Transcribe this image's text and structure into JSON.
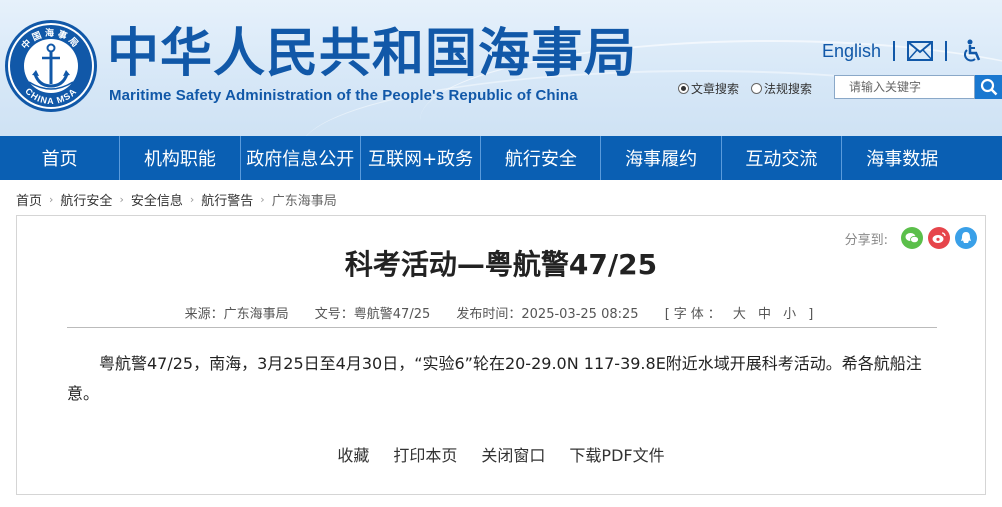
{
  "header": {
    "title_cn": "中华人民共和国海事局",
    "title_en": "Maritime Safety Administration of the People's Republic of China",
    "logo": {
      "ring_text_top": "中国海事局",
      "ring_text_bottom": "CHINA MSA",
      "icon": "anchor-emblem-icon"
    },
    "english_link": "English",
    "mail_icon": "mail-icon",
    "accessibility_icon": "accessibility-icon",
    "search": {
      "option1": "文章搜索",
      "option2": "法规搜索",
      "placeholder": "请输入关键字",
      "button_icon": "search-icon"
    }
  },
  "nav": [
    "首页",
    "机构职能",
    "政府信息公开",
    "互联网+政务",
    "航行安全",
    "海事履约",
    "互动交流",
    "海事数据"
  ],
  "breadcrumb": [
    "首页",
    "航行安全",
    "安全信息",
    "航行警告",
    "广东海事局"
  ],
  "article": {
    "share_label": "分享到:",
    "title": "科考活动—粤航警47/25",
    "meta": {
      "source": "来源：广东海事局",
      "doc_no": "文号：粤航警47/25",
      "published": "发布时间：2025-03-25 08:25",
      "font_size": "[字体： 大 中 小 ]"
    },
    "body": "粤航警47/25，南海，3月25日至4月30日，“实验6”轮在20-29.0N 117-39.8E附近水域开展科考活动。希各航船注意。",
    "actions": [
      "收藏",
      "打印本页",
      "关闭窗口",
      "下载PDF文件"
    ]
  },
  "colors": {
    "brand_blue": "#1158a8",
    "nav_blue": "#0a5fb3",
    "wechat": "#5bbf4a",
    "weibo": "#e6454b",
    "qq": "#3aa0e8"
  }
}
